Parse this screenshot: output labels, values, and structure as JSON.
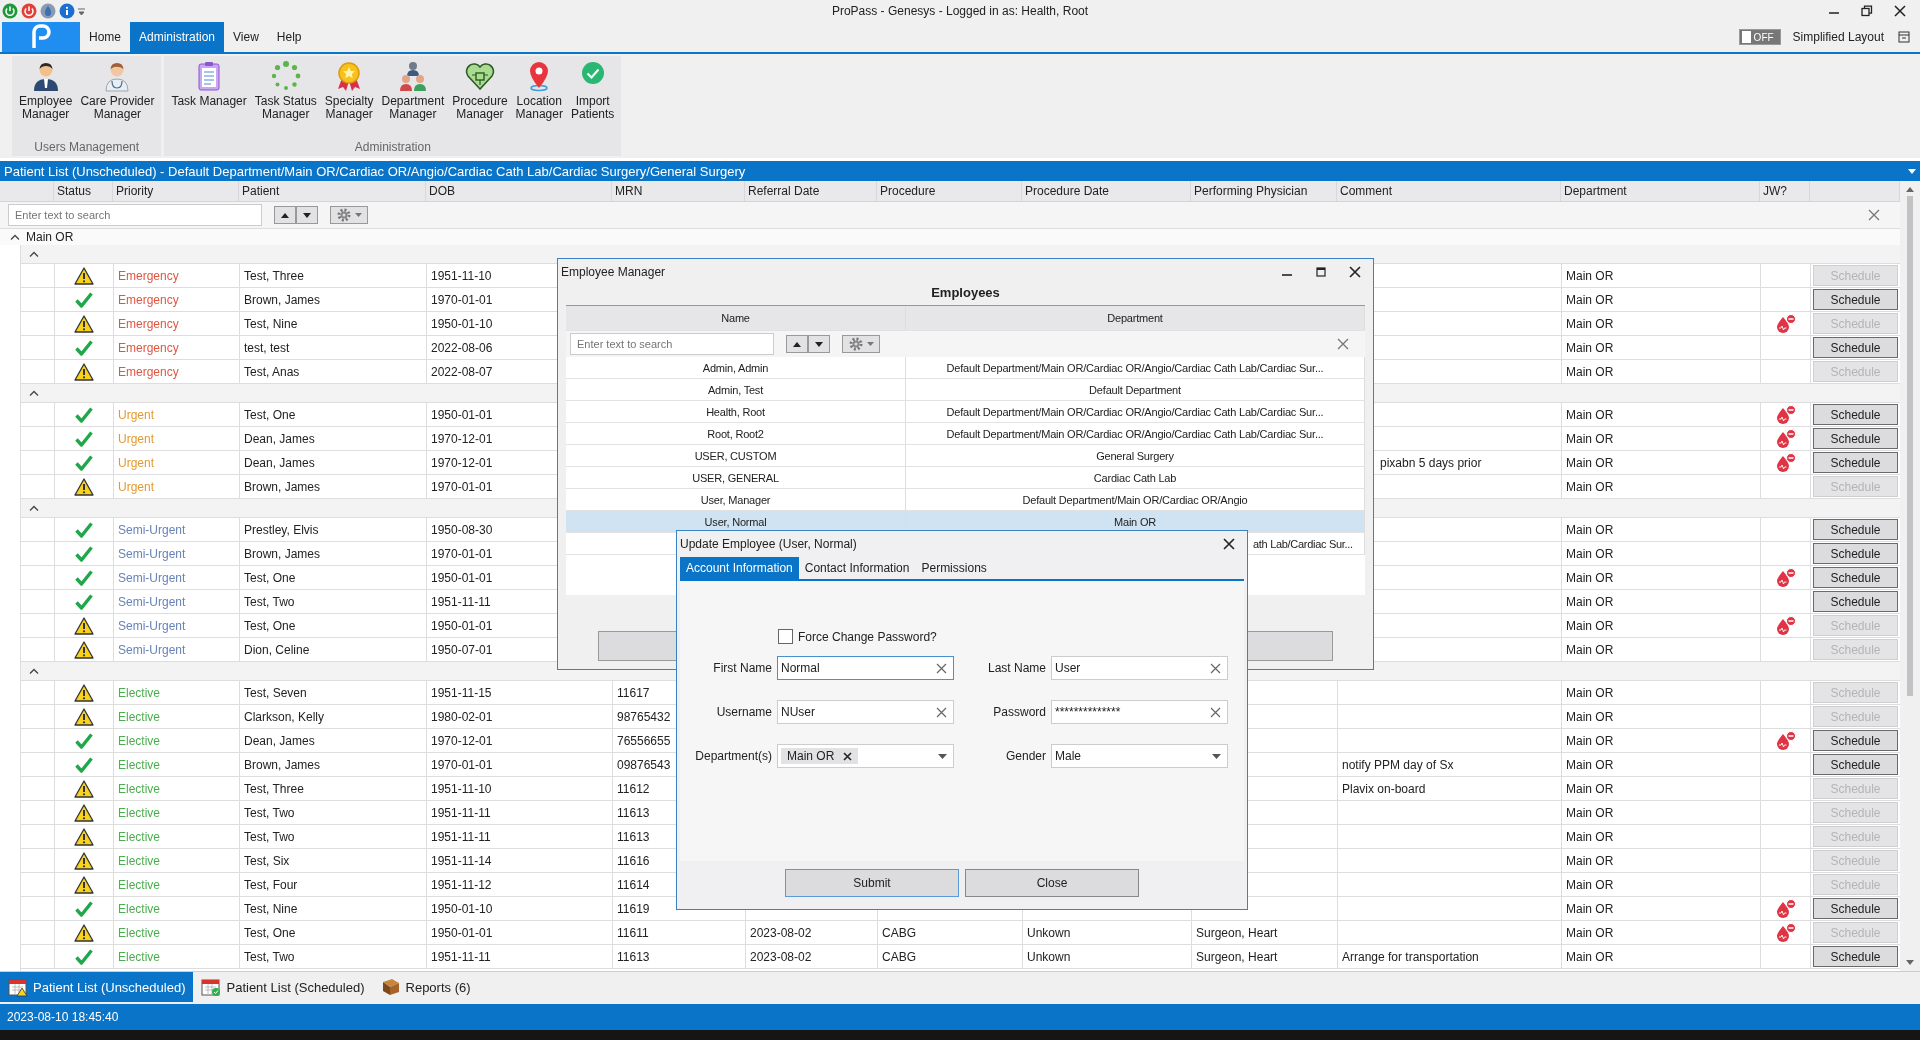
{
  "window": {
    "title": "ProPass - Genesys - Logged in as: Health, Root"
  },
  "menu": [
    {
      "label": "Home",
      "selected": false
    },
    {
      "label": "Administration",
      "selected": true
    },
    {
      "label": "View",
      "selected": false
    },
    {
      "label": "Help",
      "selected": false
    }
  ],
  "layout_toggle": {
    "state": "OFF",
    "on": false,
    "label": "Simplified Layout"
  },
  "ribbon": [
    {
      "title": "Users Management",
      "items": [
        {
          "label": "Employee\nManager"
        },
        {
          "label": "Care Provider\nManager"
        }
      ]
    },
    {
      "title": "Administration",
      "items": [
        {
          "label": "Task Manager"
        },
        {
          "label": "Task Status\nManager"
        },
        {
          "label": "Specialty\nManager"
        },
        {
          "label": "Department\nManager"
        },
        {
          "label": "Procedure\nManager"
        },
        {
          "label": "Location\nManager"
        },
        {
          "label": "Import\nPatients"
        }
      ]
    }
  ],
  "patient_list": {
    "banner": "Patient List (Unscheduled) - Default Department/Main OR/Cardiac OR/Angio/Cardiac Cath Lab/Cardiac Surgery/General Surgery",
    "columns": [
      "Status",
      "Priority",
      "Patient",
      "DOB",
      "MRN",
      "Referral Date",
      "Procedure",
      "Procedure Date",
      "Performing Physician",
      "Comment",
      "Department",
      "JW?"
    ],
    "search": {
      "placeholder": "Enter text to search"
    },
    "group": {
      "label": "Main OR",
      "expanded": true,
      "subgroups": [
        {
          "color": "#e0553f",
          "expanded": true,
          "rows": [
            {
              "ready": false,
              "priority": "Emergency",
              "patient": "Test, Three",
              "dob": "1951-11-10",
              "department": "Main OR",
              "jw": false,
              "schedule": "Schedule",
              "schedule_disabled": true
            },
            {
              "ready": true,
              "priority": "Emergency",
              "patient": "Brown, James",
              "dob": "1970-01-01",
              "department": "Main OR",
              "jw": false,
              "schedule": "Schedule",
              "schedule_disabled": false
            },
            {
              "ready": false,
              "priority": "Emergency",
              "patient": "Test, Nine",
              "dob": "1950-01-10",
              "department": "Main OR",
              "jw": true,
              "schedule": "Schedule",
              "schedule_disabled": true
            },
            {
              "ready": true,
              "priority": "Emergency",
              "patient": "test, test",
              "dob": "2022-08-06",
              "department": "Main OR",
              "jw": false,
              "schedule": "Schedule",
              "schedule_disabled": false
            },
            {
              "ready": false,
              "priority": "Emergency",
              "patient": "Test, Anas",
              "dob": "2022-08-07",
              "department": "Main OR",
              "jw": false,
              "schedule": "Schedule",
              "schedule_disabled": true
            }
          ]
        },
        {
          "color": "#e39a2d",
          "expanded": true,
          "rows": [
            {
              "ready": true,
              "priority": "Urgent",
              "patient": "Test, One",
              "dob": "1950-01-01",
              "department": "Main OR",
              "jw": true,
              "schedule": "Schedule",
              "schedule_disabled": false
            },
            {
              "ready": true,
              "priority": "Urgent",
              "patient": "Dean, James",
              "dob": "1970-12-01",
              "department": "Main OR",
              "jw": true,
              "schedule": "Schedule",
              "schedule_disabled": false
            },
            {
              "ready": true,
              "priority": "Urgent",
              "patient": "Dean, James",
              "dob": "1970-12-01",
              "comment": "pixabn 5 days prior",
              "comment_partly_hidden": true,
              "department": "Main OR",
              "jw": true,
              "schedule": "Schedule",
              "schedule_disabled": false
            },
            {
              "ready": false,
              "priority": "Urgent",
              "patient": "Brown, James",
              "dob": "1970-01-01",
              "department": "Main OR",
              "jw": false,
              "schedule": "Schedule",
              "schedule_disabled": true
            }
          ]
        },
        {
          "color": "#6883b5",
          "expanded": true,
          "rows": [
            {
              "ready": true,
              "priority": "Semi-Urgent",
              "patient": "Prestley, Elvis",
              "dob": "1950-08-30",
              "department": "Main OR",
              "jw": false,
              "schedule": "Schedule",
              "schedule_disabled": false
            },
            {
              "ready": true,
              "priority": "Semi-Urgent",
              "patient": "Brown, James",
              "dob": "1970-01-01",
              "department": "Main OR",
              "jw": false,
              "schedule": "Schedule",
              "schedule_disabled": false
            },
            {
              "ready": true,
              "priority": "Semi-Urgent",
              "patient": "Test, One",
              "dob": "1950-01-01",
              "department": "Main OR",
              "jw": true,
              "schedule": "Schedule",
              "schedule_disabled": false
            },
            {
              "ready": true,
              "priority": "Semi-Urgent",
              "patient": "Test, Two",
              "dob": "1951-11-11",
              "department": "Main OR",
              "jw": false,
              "schedule": "Schedule",
              "schedule_disabled": false
            },
            {
              "ready": false,
              "priority": "Semi-Urgent",
              "patient": "Test, One",
              "dob": "1950-01-01",
              "department": "Main OR",
              "jw": true,
              "schedule": "Schedule",
              "schedule_disabled": true
            },
            {
              "ready": false,
              "priority": "Semi-Urgent",
              "patient": "Dion, Celine",
              "dob": "1950-07-01",
              "department": "Main OR",
              "jw": false,
              "schedule": "Schedule",
              "schedule_disabled": true
            }
          ]
        },
        {
          "color": "#4cae4f",
          "expanded": true,
          "rows": [
            {
              "ready": false,
              "priority": "Elective",
              "patient": "Test, Seven",
              "dob": "1951-11-15",
              "mrn": "11617",
              "department": "Main OR",
              "jw": false,
              "schedule": "Schedule",
              "schedule_disabled": true
            },
            {
              "ready": false,
              "priority": "Elective",
              "patient": "Clarkson, Kelly",
              "dob": "1980-02-01",
              "mrn": "98765432",
              "department": "Main OR",
              "jw": false,
              "schedule": "Schedule",
              "schedule_disabled": true
            },
            {
              "ready": true,
              "priority": "Elective",
              "patient": "Dean, James",
              "dob": "1970-12-01",
              "mrn": "76556655",
              "department": "Main OR",
              "jw": true,
              "schedule": "Schedule",
              "schedule_disabled": false
            },
            {
              "ready": true,
              "priority": "Elective",
              "patient": "Brown, James",
              "dob": "1970-01-01",
              "mrn": "09876543",
              "comment": "notify PPM day of Sx",
              "department": "Main OR",
              "jw": false,
              "schedule": "Schedule",
              "schedule_disabled": false
            },
            {
              "ready": false,
              "priority": "Elective",
              "patient": "Test, Three",
              "dob": "1951-11-10",
              "mrn": "11612",
              "comment": "Plavix on-board",
              "department": "Main OR",
              "jw": false,
              "schedule": "Schedule",
              "schedule_disabled": true
            },
            {
              "ready": false,
              "priority": "Elective",
              "patient": "Test, Two",
              "dob": "1951-11-11",
              "mrn": "11613",
              "department": "Main OR",
              "jw": false,
              "schedule": "Schedule",
              "schedule_disabled": true
            },
            {
              "ready": false,
              "priority": "Elective",
              "patient": "Test, Two",
              "dob": "1951-11-11",
              "mrn": "11613",
              "department": "Main OR",
              "jw": false,
              "schedule": "Schedule",
              "schedule_disabled": true
            },
            {
              "ready": false,
              "priority": "Elective",
              "patient": "Test, Six",
              "dob": "1951-11-14",
              "mrn": "11616",
              "department": "Main OR",
              "jw": false,
              "schedule": "Schedule",
              "schedule_disabled": true
            },
            {
              "ready": false,
              "priority": "Elective",
              "patient": "Test, Four",
              "dob": "1951-11-12",
              "mrn": "11614",
              "department": "Main OR",
              "jw": false,
              "schedule": "Schedule",
              "schedule_disabled": true
            },
            {
              "ready": true,
              "priority": "Elective",
              "patient": "Test, Nine",
              "dob": "1950-01-10",
              "mrn": "11619",
              "department": "Main OR",
              "jw": true,
              "schedule": "Schedule",
              "schedule_disabled": false
            },
            {
              "ready": false,
              "priority": "Elective",
              "patient": "Test, One",
              "dob": "1950-01-01",
              "mrn": "11611",
              "referral_date": "2023-08-02",
              "procedure": "CABG",
              "procedure_date": "Unkown",
              "physician": "Surgeon, Heart",
              "department": "Main OR",
              "jw": true,
              "schedule": "Schedule",
              "schedule_disabled": true
            },
            {
              "ready": true,
              "priority": "Elective",
              "patient": "Test, Two",
              "dob": "1951-11-11",
              "mrn": "11613",
              "referral_date": "2023-08-02",
              "procedure": "CABG",
              "procedure_date": "Unkown",
              "physician": "Surgeon, Heart",
              "comment": "Arrange for transportation",
              "department": "Main OR",
              "jw": false,
              "schedule": "Schedule",
              "schedule_disabled": false
            }
          ]
        }
      ]
    }
  },
  "employee_manager": {
    "title": "Employee Manager",
    "heading": "Employees",
    "columns": [
      "Name",
      "Department"
    ],
    "search": {
      "placeholder": "Enter text to search"
    },
    "rows": [
      {
        "name": "Admin, Admin",
        "department": "Default Department/Main OR/Cardiac OR/Angio/Cardiac Cath Lab/Cardiac Sur...",
        "selected": false
      },
      {
        "name": "Admin, Test",
        "department": "Default Department",
        "selected": false
      },
      {
        "name": "Health, Root",
        "department": "Default Department/Main OR/Cardiac OR/Angio/Cardiac Cath Lab/Cardiac Sur...",
        "selected": false
      },
      {
        "name": "Root, Root2",
        "department": "Default Department/Main OR/Cardiac OR/Angio/Cardiac Cath Lab/Cardiac Sur...",
        "selected": false
      },
      {
        "name": "USER, CUSTOM",
        "department": "General Surgery",
        "selected": false
      },
      {
        "name": "USER, GENERAL",
        "department": "Cardiac Cath Lab",
        "selected": false
      },
      {
        "name": "User, Manager",
        "department": "Default Department/Main OR/Cardiac OR/Angio",
        "selected": false
      },
      {
        "name": "User, Normal",
        "department": "Main OR",
        "selected": true
      },
      {
        "department": "ath Lab/Cardiac Sur...",
        "partly_hidden": true,
        "selected": false
      }
    ]
  },
  "update_employee": {
    "title": "Update Employee (User, Normal)",
    "tabs": [
      {
        "label": "Account Information",
        "selected": true
      },
      {
        "label": "Contact Information",
        "selected": false
      },
      {
        "label": "Permissions",
        "selected": false
      }
    ],
    "force_change_password": {
      "label": "Force Change Password?",
      "checked": false
    },
    "fields": [
      {
        "kind": "text",
        "label": "First Name",
        "value": "Normal",
        "focused": true
      },
      {
        "kind": "text",
        "label": "Last Name",
        "value": "User",
        "focused": false
      },
      {
        "kind": "text",
        "label": "Username",
        "value": "NUser",
        "focused": false
      },
      {
        "kind": "text",
        "label": "Password",
        "value": "**************",
        "focused": false
      },
      {
        "kind": "tags",
        "label": "Department(s)",
        "tags": [
          "Main OR"
        ],
        "focused": false
      },
      {
        "kind": "select",
        "label": "Gender",
        "value": "Male",
        "focused": false
      }
    ],
    "buttons": [
      "Submit",
      "Close"
    ]
  },
  "bottom_tabs": [
    {
      "label": "Patient List (Unscheduled)",
      "selected": true
    },
    {
      "label": "Patient List (Scheduled)",
      "selected": false
    },
    {
      "label": "Reports (6)",
      "selected": false
    }
  ],
  "status_bar": {
    "timestamp": "2023-08-10 18:45:40"
  }
}
